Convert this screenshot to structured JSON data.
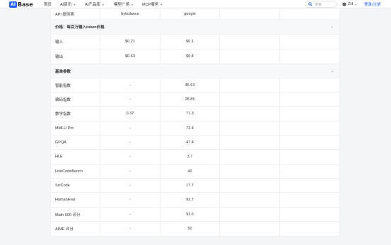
{
  "brand": {
    "logo_mark": "AI",
    "name": "Base"
  },
  "nav": [
    {
      "label": "首页",
      "has_menu": false
    },
    {
      "label": "AI资讯",
      "has_menu": true
    },
    {
      "label": "AI产品库",
      "has_menu": true
    },
    {
      "label": "模型广场",
      "has_menu": true
    },
    {
      "label": "MCP服务",
      "has_menu": true
    }
  ],
  "search": {
    "placeholder": "搜索",
    "icon": "search-icon"
  },
  "lang": {
    "label": "ZH",
    "icon": "globe-icon"
  },
  "login": {
    "label": "登录/注册"
  },
  "table": {
    "provider_row": {
      "label": "API 提供商",
      "values": [
        "bytedance",
        "google"
      ]
    },
    "price_section": {
      "title": "价格：每百万输入token价格"
    },
    "price_rows": [
      {
        "label": "输入",
        "values": [
          "$0.21",
          "$0.1"
        ]
      },
      {
        "label": "输出",
        "values": [
          "$0.63",
          "$0.4"
        ]
      }
    ],
    "params_section": {
      "title": "基准参数"
    },
    "param_rows": [
      {
        "label": "智能指数",
        "values": [
          "-",
          "45.63"
        ]
      },
      {
        "label": "编码指数",
        "values": [
          "-",
          "28.85"
        ]
      },
      {
        "label": "数学指数",
        "values": [
          "0.37",
          "71.3"
        ]
      },
      {
        "label": "MMLU Pro",
        "values": [
          "-",
          "72.4"
        ]
      },
      {
        "label": "GPQA",
        "values": [
          "-",
          "47.4"
        ]
      },
      {
        "label": "HLE",
        "values": [
          "-",
          "3.7"
        ]
      },
      {
        "label": "LiveCodeBench",
        "values": [
          "-",
          "40"
        ]
      },
      {
        "label": "SciCode",
        "values": [
          "-",
          "17.7"
        ]
      },
      {
        "label": "HumanEval",
        "values": [
          "-",
          "92.7"
        ]
      },
      {
        "label": "Math 500 评分",
        "values": [
          "-",
          "92.6"
        ]
      },
      {
        "label": "AIME 评分",
        "values": [
          "-",
          "50"
        ]
      }
    ]
  }
}
